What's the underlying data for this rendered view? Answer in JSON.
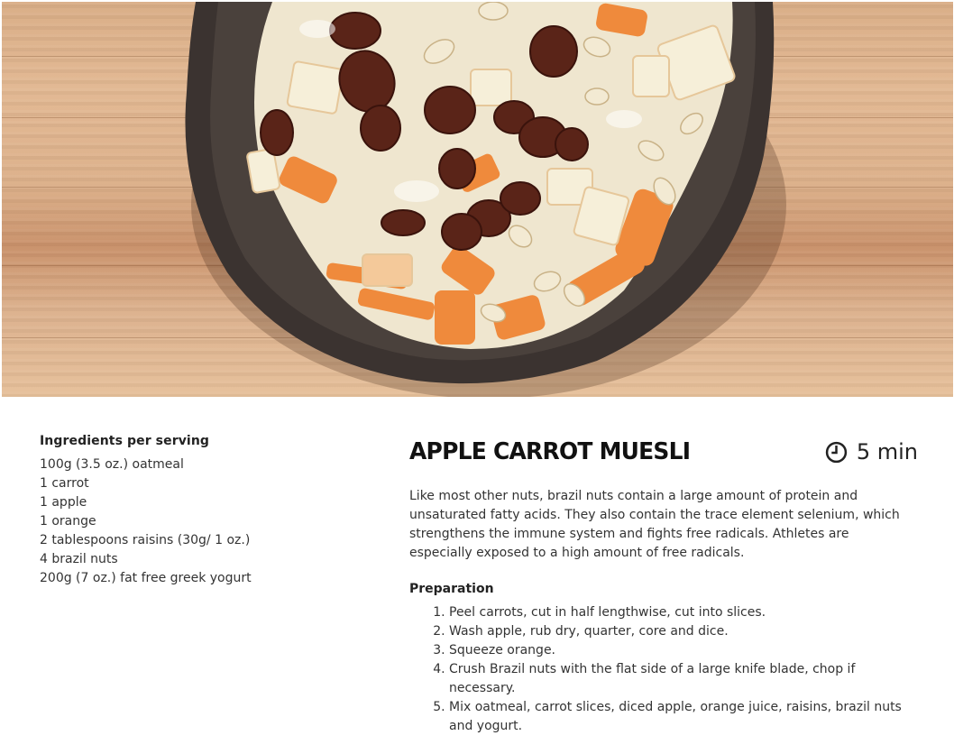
{
  "hero": {
    "image": "apple-carrot-muesli-bowl-photo"
  },
  "ingredients": {
    "heading": "Ingredients per serving",
    "items": [
      "100g (3.5 oz.) oatmeal",
      "1 carrot",
      "1 apple",
      "1 orange",
      "2 tablespoons raisins (30g/ 1 oz.)",
      "4 brazil nuts",
      "200g (7 oz.) fat free greek yogurt"
    ]
  },
  "recipe": {
    "title": "APPLE CARROT MUESLI",
    "time": "5 min",
    "time_icon": "clock-icon",
    "description": "Like most other nuts, brazil nuts contain a large amount of protein and unsaturated fatty acids. They also contain the trace element selenium, which strengthens the immune system and fights free radicals. Athletes are especially exposed to a high amount of free radicals.",
    "preparation_heading": "Preparation",
    "steps": [
      "Peel carrots, cut in half lengthwise, cut into slices.",
      "Wash apple, rub dry, quarter, core and dice.",
      "Squeeze orange.",
      "Crush Brazil nuts with the flat side of a large knife blade, chop if necessary.",
      "Mix oatmeal, carrot slices, diced apple, orange juice, raisins, brazil nuts and yogurt."
    ]
  },
  "colors": {
    "wood": "#dcb08a",
    "bowl": "#3b3330",
    "carrot": "#ef8a3c",
    "raisin": "#5a2418",
    "yogurt": "#f1ead6"
  }
}
